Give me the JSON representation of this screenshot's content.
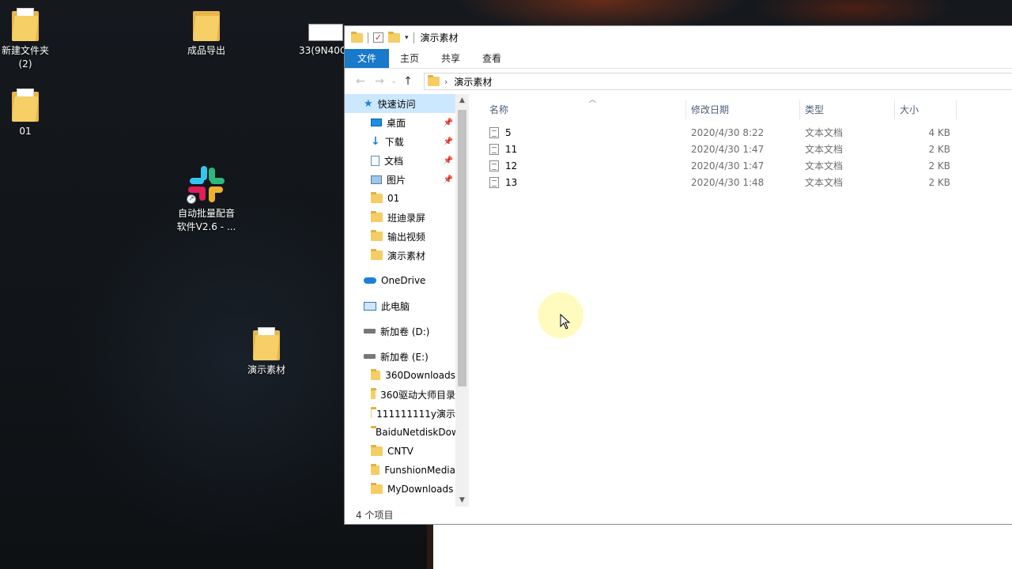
{
  "desktop": {
    "icons": [
      {
        "label": "新建文件夹\n(2)",
        "icon": "folder-icon"
      },
      {
        "label": "成品导出",
        "icon": "folder-icon"
      },
      {
        "label": "33(9N40C",
        "icon": "image-file-icon"
      },
      {
        "label": "01",
        "icon": "folder-icon"
      },
      {
        "label": "自动批量配音\n软件V2.6 - ...",
        "icon": "slack-shortcut-icon"
      },
      {
        "label": "演示素材",
        "icon": "folder-icon"
      }
    ]
  },
  "explorer": {
    "title": "演示素材",
    "ribbon_tabs": [
      "文件",
      "主页",
      "共享",
      "查看"
    ],
    "address": {
      "path": "演示素材"
    },
    "nav": {
      "quick_access": "快速访问",
      "pinned": [
        "桌面",
        "下载",
        "文档",
        "图片"
      ],
      "recent": [
        "01",
        "班迪录屏",
        "输出视频",
        "演示素材"
      ],
      "onedrive": "OneDrive",
      "this_pc": "此电脑",
      "drive_d": "新加卷 (D:)",
      "drive_e": "新加卷 (E:)",
      "drive_e_items": [
        "360Downloads",
        "360驱动大师目录",
        "111111111y演示",
        "BaiduNetdiskDownload",
        "CNTV",
        "FunshionMedia",
        "MyDownloads"
      ]
    },
    "columns": {
      "name": "名称",
      "date": "修改日期",
      "type": "类型",
      "size": "大小"
    },
    "files": [
      {
        "name": "5",
        "date": "2020/4/30 8:22",
        "type": "文本文档",
        "size": "4 KB"
      },
      {
        "name": "11",
        "date": "2020/4/30 1:47",
        "type": "文本文档",
        "size": "2 KB"
      },
      {
        "name": "12",
        "date": "2020/4/30 1:47",
        "type": "文本文档",
        "size": "2 KB"
      },
      {
        "name": "13",
        "date": "2020/4/30 1:48",
        "type": "文本文档",
        "size": "2 KB"
      }
    ],
    "status": "4 个项目"
  }
}
